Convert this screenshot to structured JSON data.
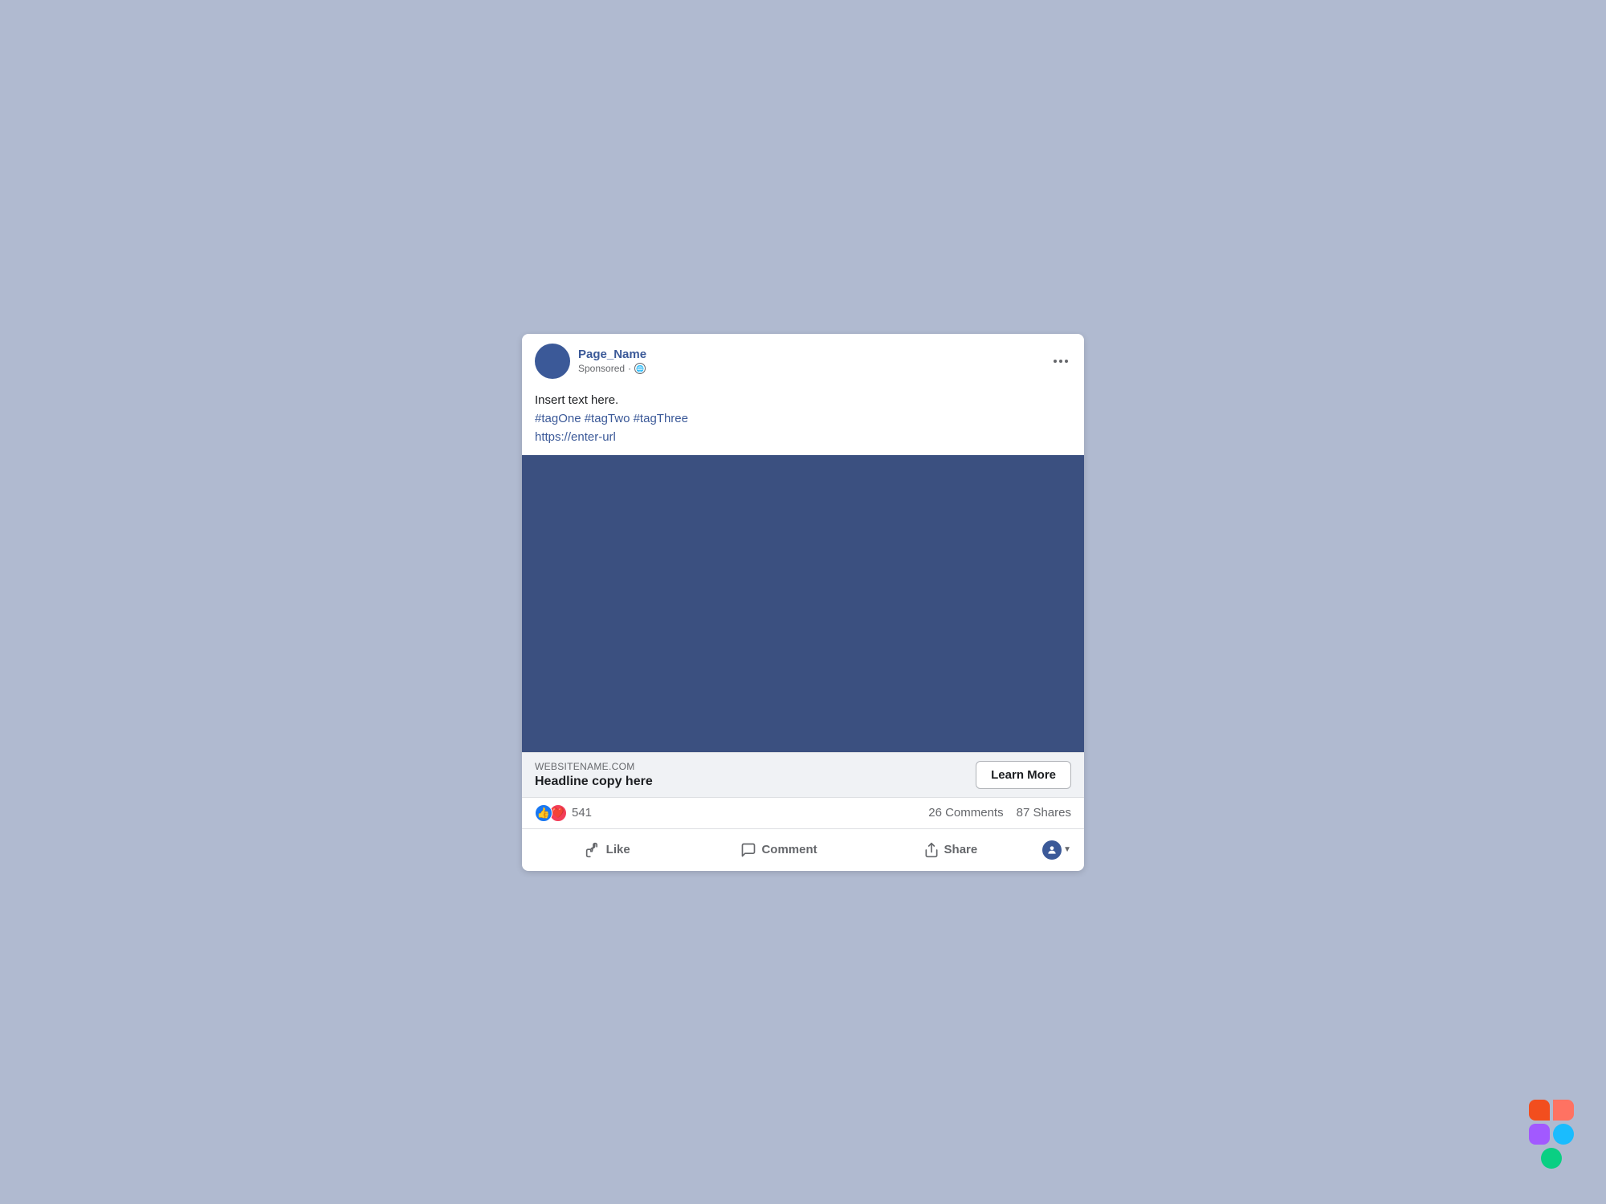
{
  "page": {
    "name": "Page_Name",
    "sponsored": "Sponsored",
    "more_options_label": "More options"
  },
  "post": {
    "body_text": "Insert text here.",
    "hashtags": "#tagOne #tagTwo #tagThree",
    "url": "https://enter-url"
  },
  "link_preview": {
    "domain": "WEBSITENAME.COM",
    "headline": "Headline copy here",
    "cta_button": "Learn More"
  },
  "reactions": {
    "count": "541",
    "comments": "26 Comments",
    "shares": "87 Shares"
  },
  "actions": {
    "like": "Like",
    "comment": "Comment",
    "share": "Share"
  },
  "background": {
    "color": "#b0bad0"
  },
  "image": {
    "color": "#3b5080"
  }
}
